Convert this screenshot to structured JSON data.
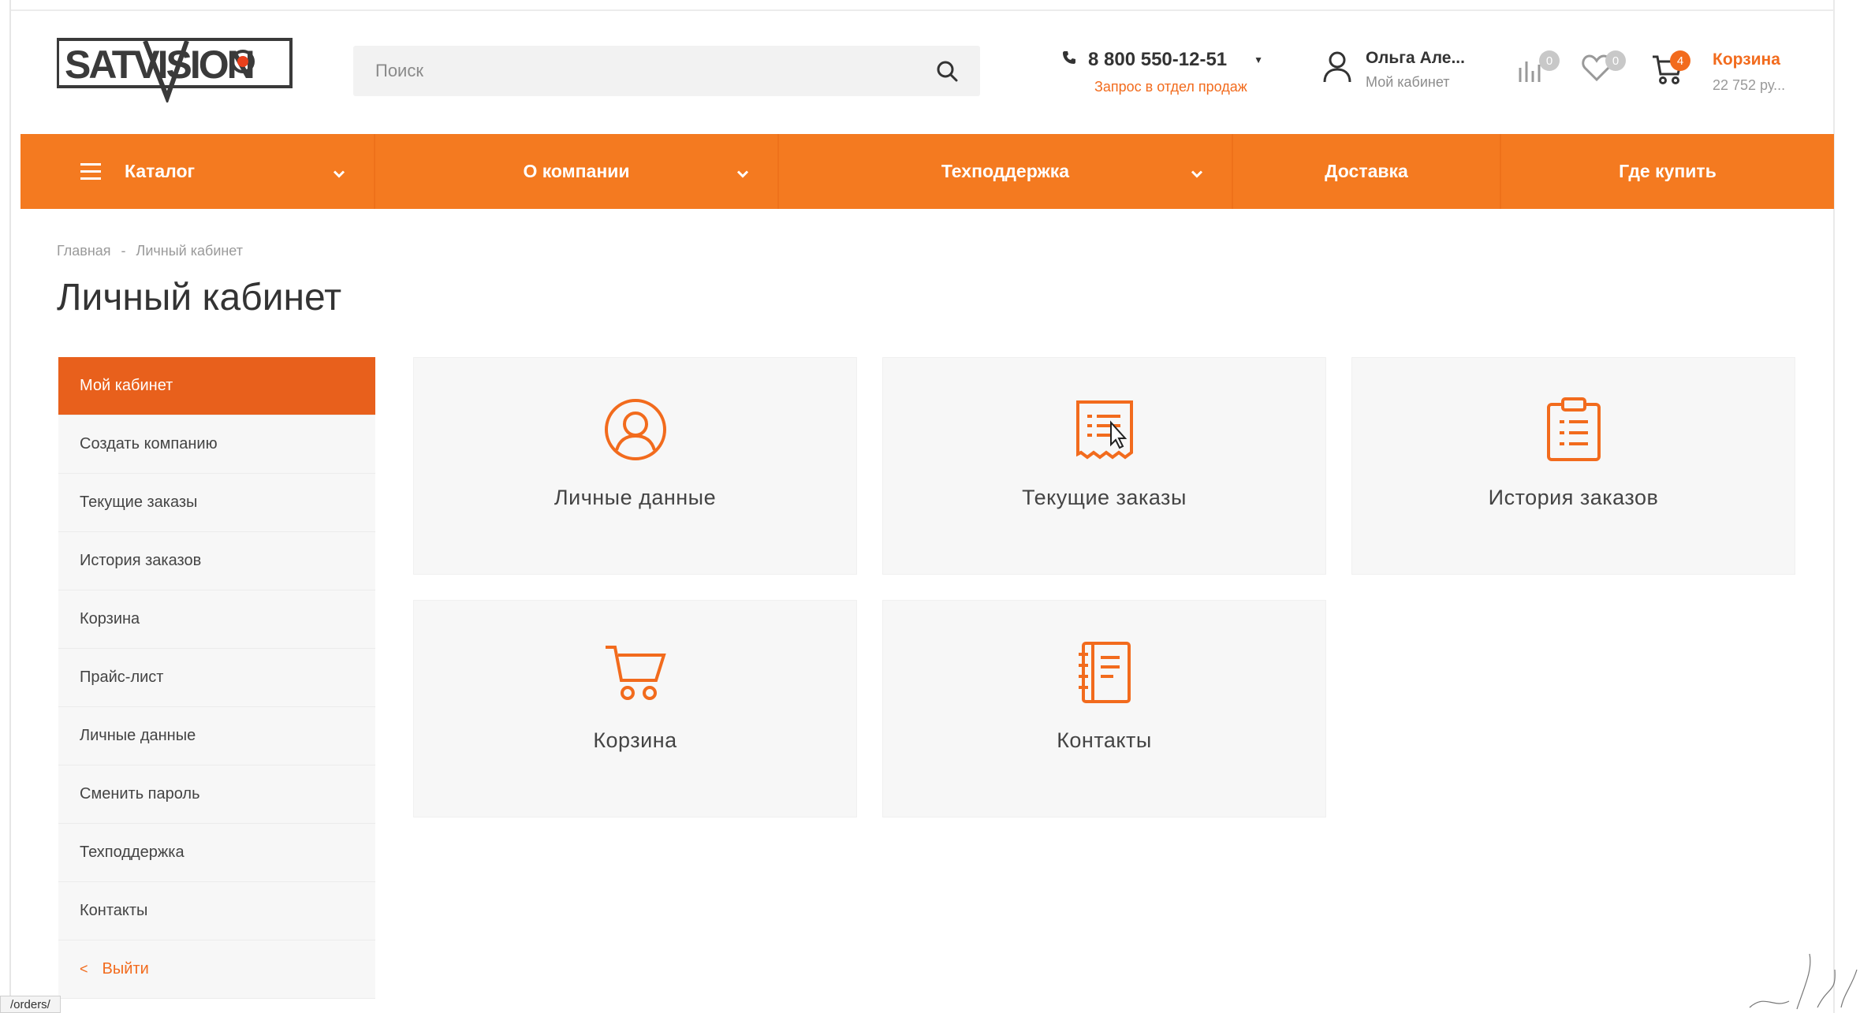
{
  "header": {
    "logo_text": "SATVISION",
    "search_placeholder": "Поиск",
    "phone": "8 800 550-12-51",
    "phone_request": "Запрос в отдел продаж",
    "user_name": "Ольга Але...",
    "user_sub": "Мой кабинет",
    "compare_count": "0",
    "favorites_count": "0",
    "cart_count": "4",
    "cart_label": "Корзина",
    "cart_sum": "22 752 ру..."
  },
  "nav": {
    "catalog": "Каталог",
    "company": "О компании",
    "support": "Техподдержка",
    "delivery": "Доставка",
    "where_to_buy": "Где купить"
  },
  "breadcrumb": {
    "home": "Главная",
    "sep": "-",
    "current": "Личный кабинет"
  },
  "page_title": "Личный кабинет",
  "sidebar": {
    "items": [
      "Мой кабинет",
      "Создать компанию",
      "Текущие заказы",
      "История заказов",
      "Корзина",
      "Прайс-лист",
      "Личные данные",
      "Сменить пароль",
      "Техподдержка",
      "Контакты"
    ],
    "logout": "Выйти"
  },
  "tiles": {
    "personal": "Личные данные",
    "current_orders": "Текущие заказы",
    "history": "История заказов",
    "cart": "Корзина",
    "contacts": "Контакты"
  },
  "status_url": "/orders/",
  "colors": {
    "accent": "#f47a20",
    "accent_dark": "#e8601c",
    "text": "#333333"
  }
}
